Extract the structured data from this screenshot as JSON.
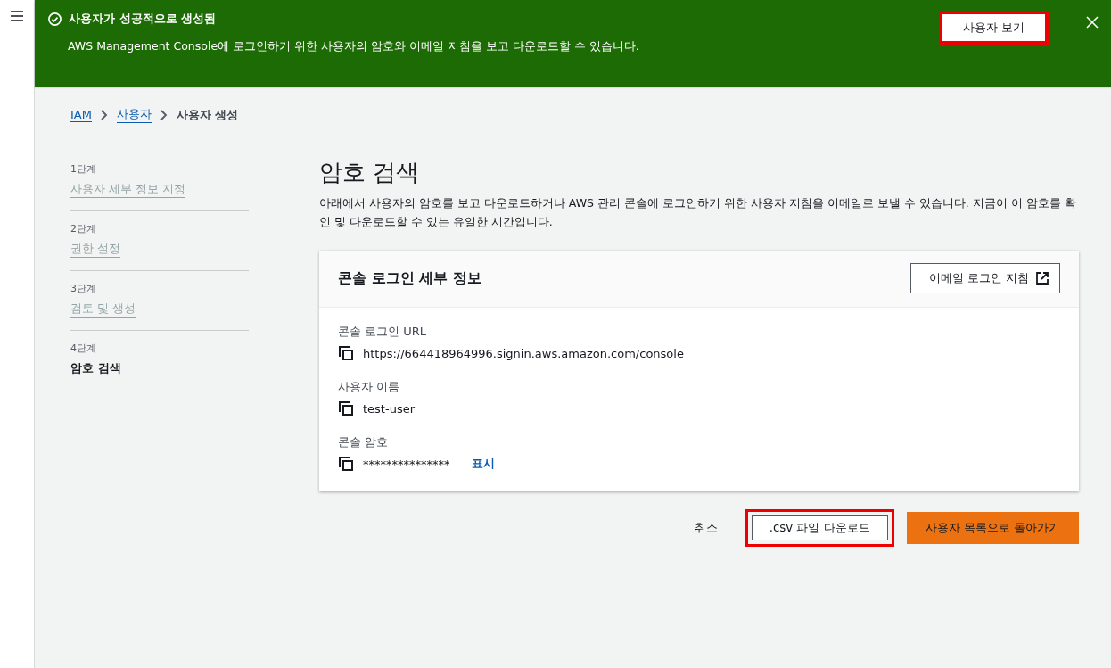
{
  "flash": {
    "title": "사용자가 성공적으로 생성됨",
    "message": "AWS Management Console에 로그인하기 위한 사용자의 암호와 이메일 지침을 보고 다운로드할 수 있습니다.",
    "action": {
      "label": "사용자 보기",
      "highlighted": true
    }
  },
  "breadcrumbs": [
    {
      "label": "IAM",
      "kind": "link"
    },
    {
      "label": "사용자",
      "kind": "link"
    },
    {
      "label": "사용자 생성",
      "kind": "current"
    }
  ],
  "steps": [
    {
      "number": "1단계",
      "title": "사용자 세부 정보 지정",
      "selected": false
    },
    {
      "number": "2단계",
      "title": "권한 설정",
      "selected": false
    },
    {
      "number": "3단계",
      "title": "검토 및 생성",
      "selected": false
    },
    {
      "number": "4단계",
      "title": "암호 검색",
      "selected": true
    }
  ],
  "page": {
    "title": "암호 검색",
    "description": "아래에서 사용자의 암호를 보고 다운로드하거나 AWS 관리 콘솔에 로그인하기 위한 사용자 지침을 이메일로 보낼 수 있습니다. 지금이 이 암호를 확인 및 다운로드할 수 있는 유일한 시간입니다."
  },
  "card": {
    "title": "콘솔 로그인 세부 정보",
    "email_button": "이메일 로그인 지침",
    "fields": [
      {
        "label": "콘솔 로그인 URL",
        "value": "https://664418964996.signin.aws.amazon.com/console"
      },
      {
        "label": "사용자 이름",
        "value": "test-user"
      },
      {
        "label": "콘솔 암호",
        "value": "***************",
        "link": "표시"
      }
    ]
  },
  "footer_buttons": [
    {
      "label": "취소",
      "kind": "link",
      "highlighted": false
    },
    {
      "label": ".csv 파일 다운로드",
      "kind": "normal",
      "highlighted": true
    },
    {
      "label": "사용자 목록으로 돌아가기",
      "kind": "primary",
      "highlighted": false
    }
  ]
}
